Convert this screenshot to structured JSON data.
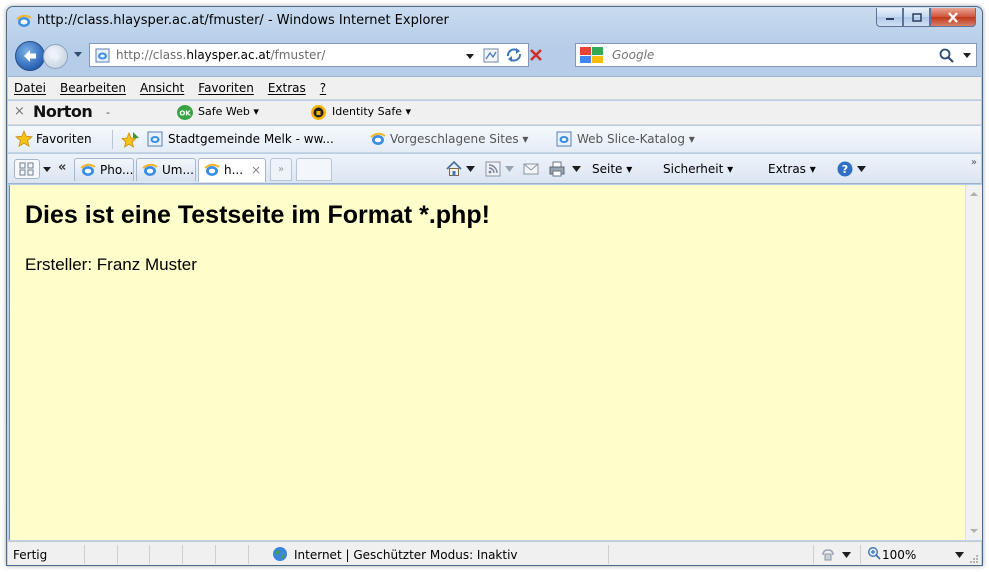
{
  "window": {
    "title": "http://class.hlaysper.ac.at/fmuster/ - Windows Internet Explorer"
  },
  "address": {
    "url_prefix": "http://class.",
    "url_domain": "hlaysper.ac.at",
    "url_suffix": "/fmuster/"
  },
  "search": {
    "placeholder": "Google"
  },
  "menu": {
    "items": [
      "Datei",
      "Bearbeiten",
      "Ansicht",
      "Favoriten",
      "Extras",
      "?"
    ]
  },
  "norton": {
    "close_glyph": "×",
    "logo": "Norton",
    "dropdown": "-",
    "safe_web": "Safe Web ▾",
    "identity_safe": "Identity Safe ▾"
  },
  "favorites": {
    "label": "Favoriten",
    "links": [
      "Stadtgemeinde Melk - ww...",
      "Vorgeschlagene Sites ▾",
      "Web Slice-Katalog ▾"
    ]
  },
  "tabs": {
    "list_glyph": "«",
    "items": [
      {
        "label": "Pho..."
      },
      {
        "label": "Um..."
      },
      {
        "label": "h...",
        "close": "×"
      }
    ],
    "scroll_glyph": "»"
  },
  "commands": {
    "page": "Seite ▾",
    "safety": "Sicherheit ▾",
    "tools": "Extras ▾",
    "more": "»"
  },
  "content": {
    "heading": "Dies ist eine Testseite im Format *.php!",
    "author": "Ersteller: Franz Muster",
    "background": "#ffffcc"
  },
  "status": {
    "text": "Fertig",
    "zone": "Internet | Geschützter Modus: Inaktiv",
    "zoom": "100%"
  }
}
